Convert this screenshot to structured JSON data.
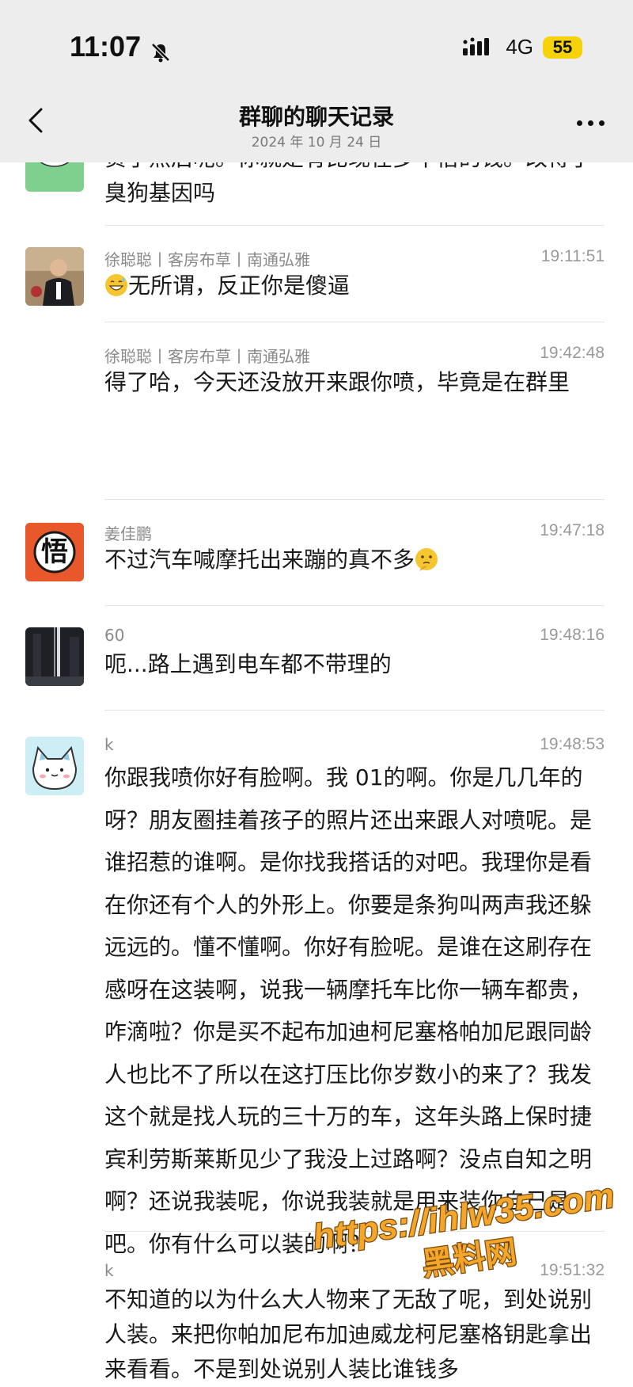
{
  "status_bar": {
    "time": "11:07",
    "network": "4G",
    "battery": "55",
    "battery_color": "#f5d20a"
  },
  "nav": {
    "title": "群聊的聊天记录",
    "subtitle": "2024 年 10 月 24 日",
    "back_icon": "chevron-left-icon",
    "more_icon": "more-dots-icon"
  },
  "messages": [
    {
      "sender": "",
      "time": "",
      "text": "贵了然后呢。你就是有比现在多十倍的钱。改得了臭狗基因吗",
      "avatar": "cartoon-cat-avatar"
    },
    {
      "sender": "徐聪聪丨客房布草丨南通弘雅",
      "time": "19:11:51",
      "text": "无所谓，反正你是傻逼",
      "emoji": "grinning-sweat-emoji",
      "avatar": "person-photo-avatar"
    },
    {
      "sender": "徐聪聪丨客房布草丨南通弘雅",
      "time": "19:42:48",
      "text": "得了哈，今天还没放开来跟你喷，毕竟是在群里"
    },
    {
      "sender": "姜佳鹏",
      "time": "19:47:18",
      "text": "不过汽车喊摩托出来蹦的真不多",
      "emoji": "thinking-face-emoji",
      "avatar": "wu-kanji-avatar",
      "avatar_char": "悟"
    },
    {
      "sender": "60",
      "time": "19:48:16",
      "text": "呃...路上遇到电车都不带理的",
      "avatar": "city-night-avatar"
    },
    {
      "sender": "k",
      "time": "19:48:53",
      "text": "你跟我喷你好有脸啊。我 01的啊。你是几几年的呀？朋友圈挂着孩子的照片还出来跟人对喷呢。是谁招惹的谁啊。是你找我搭话的对吧。我理你是看在你还有个人的外形上。你要是条狗叫两声我还躲远远的。懂不懂啊。你好有脸呢。是谁在这刷存在感呀在这装啊，说我一辆摩托车比你一辆车都贵，咋滴啦？你是买不起布加迪柯尼塞格帕加尼跟同龄人也比不了所以在这打压比你岁数小的来了？我发这个就是找人玩的三十万的车，这年头路上保时捷宾利劳斯莱斯见少了我没上过路啊？没点自知之明啊？还说我装呢，你说我装就是用来装你自己是吧。你有什么可以装的啊？",
      "avatar": "cartoon-cat-avatar"
    },
    {
      "sender": "k",
      "time": "19:51:32",
      "text": "不知道的以为什么大人物来了无敌了呢，到处说别人装。来把你帕加尼布加迪威龙柯尼塞格钥匙拿出来看看。不是到处说别人装比谁钱多"
    }
  ],
  "watermark": {
    "line1": "https://ihlw35.com",
    "line2": "黑料网"
  }
}
